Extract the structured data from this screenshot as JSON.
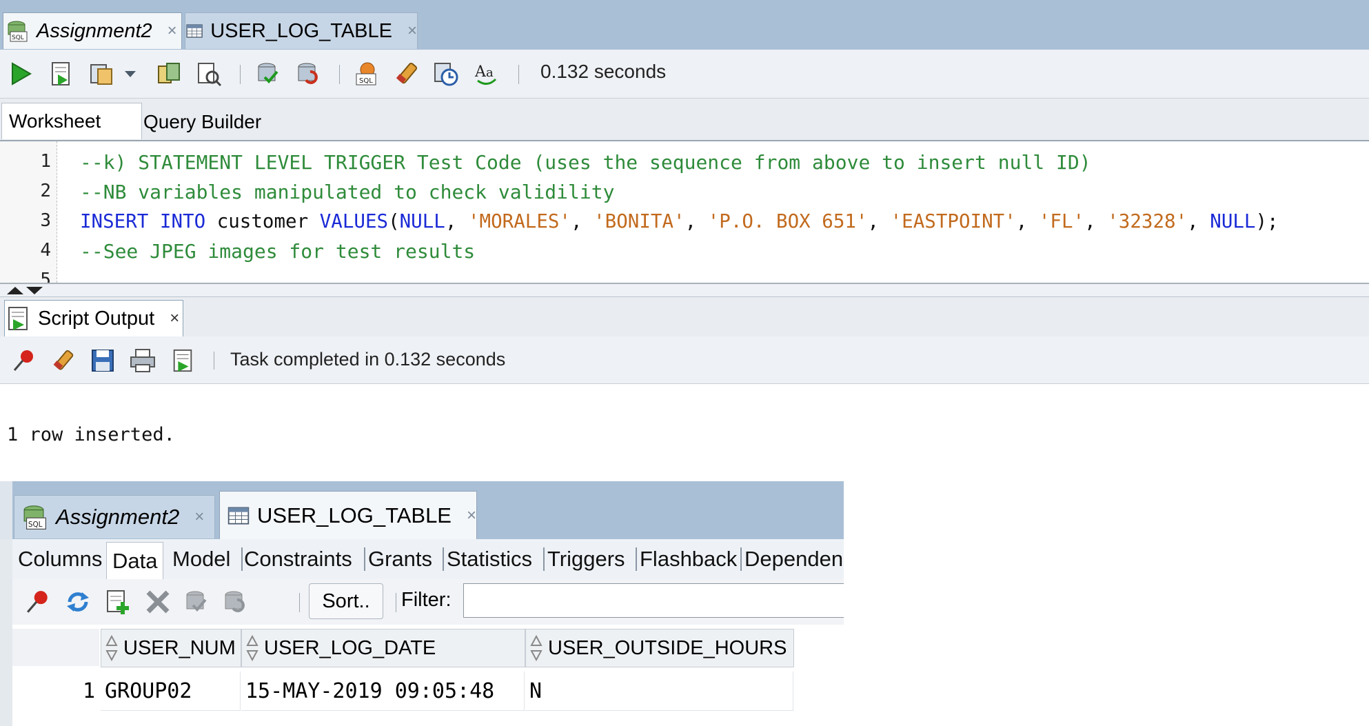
{
  "top_tabs": [
    {
      "label": "Assignment2",
      "icon": "sql-worksheet-icon",
      "italic": true,
      "active": true
    },
    {
      "label": "USER_LOG_TABLE",
      "icon": "table-icon",
      "italic": false,
      "active": false
    }
  ],
  "toolbar": {
    "items": [
      "run-statement-icon",
      "run-script-icon",
      "autotrace-icon",
      "dropdown-arrow-icon",
      "explain-plan-icon",
      "sql-tuning-icon",
      "commit-icon",
      "rollback-icon",
      "unshared-sql-icon",
      "clear-icon",
      "history-icon",
      "format-icon"
    ],
    "timing": "0.132 seconds"
  },
  "sub_tabs": [
    "Worksheet",
    "Query Builder"
  ],
  "editor": {
    "line_numbers": [
      "1",
      "2",
      "3",
      "4",
      "5"
    ],
    "line1": "--k) STATEMENT LEVEL TRIGGER Test Code (uses the sequence from above to insert null ID)",
    "line2": "--NB variables manipulated to check validility",
    "line3": {
      "insert": "INSERT",
      "into": "INTO",
      "table": " customer ",
      "values": "VALUES",
      "open": "(",
      "null1": "NULL",
      "sep1": ", ",
      "v1": "'MORALES'",
      "sep2": ", ",
      "v2": "'BONITA'",
      "sep3": ", ",
      "v3": "'P.O. BOX 651'",
      "sep4": ", ",
      "v4": "'EASTPOINT'",
      "sep5": ", ",
      "v5": "'FL'",
      "sep6": ", ",
      "v6": "'32328'",
      "sep7": ", ",
      "null2": "NULL",
      "close": ");"
    },
    "line4": "--See JPEG images for test results"
  },
  "script_output": {
    "tab_label": "Script Output",
    "close": "×",
    "status": "Task completed in 0.132 seconds",
    "body": "1 row inserted."
  },
  "lower": {
    "tabs": [
      {
        "label": "Assignment2",
        "italic": true
      },
      {
        "label": "USER_LOG_TABLE",
        "italic": false
      }
    ],
    "sub_tabs": [
      "Columns",
      "Data",
      "Model",
      "Constraints",
      "Grants",
      "Statistics",
      "Triggers",
      "Flashback",
      "Dependen"
    ],
    "active_sub_tab": "Data",
    "sort_label": "Sort..",
    "filter_label": "Filter:",
    "filter_value": "",
    "columns": [
      "USER_NUM",
      "USER_LOG_DATE",
      "USER_OUTSIDE_HOURS"
    ],
    "rows": [
      {
        "num": "1",
        "cells": [
          "GROUP02",
          "15-MAY-2019 09:05:48",
          "N"
        ]
      }
    ]
  },
  "close_glyph": "×",
  "colors": {
    "tabbar": "#a9bfd6",
    "comment": "#2e8b3a",
    "keyword": "#1a2ad6",
    "string": "#c26a1d"
  }
}
